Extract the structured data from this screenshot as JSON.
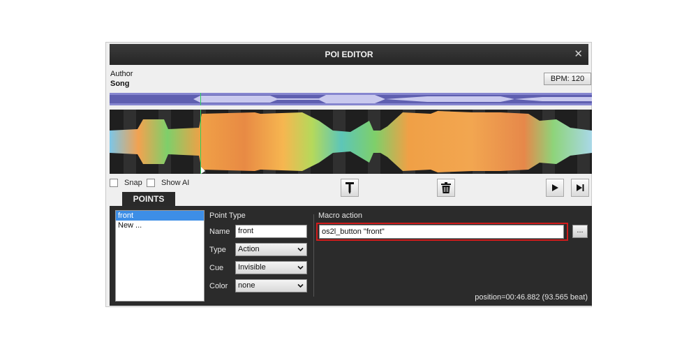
{
  "window": {
    "title": "POI EDITOR",
    "close_glyph": "✕"
  },
  "track": {
    "author": "Author",
    "song": "Song",
    "bpm": "BPM: 120"
  },
  "toolbar": {
    "snap_label": "Snap",
    "show_ai_label": "Show AI",
    "snap_checked": false,
    "show_ai_checked": false,
    "buttons": [
      "marker-icon",
      "trash-icon",
      "play-icon",
      "skip-forward-icon"
    ]
  },
  "tabs": {
    "points": "POINTS"
  },
  "points": {
    "items": [
      "front",
      "New ..."
    ],
    "selected": "front"
  },
  "form": {
    "point_type_label": "Point Type",
    "name_label": "Name",
    "name_value": "front",
    "type_label": "Type",
    "type_value": "Action",
    "cue_label": "Cue",
    "cue_value": "Invisible",
    "color_label": "Color",
    "color_value": "none"
  },
  "macro": {
    "label": "Macro action",
    "value": "os2l_button \"front\"",
    "browse_label": "..."
  },
  "status": {
    "position": "position=00:46.882 (93.565 beat)"
  },
  "colors": {
    "highlight_border": "#d11c1c",
    "selection": "#3d8ee6",
    "overview_bg": "#5f5fb0",
    "panel_bg": "#2b2b2b"
  }
}
